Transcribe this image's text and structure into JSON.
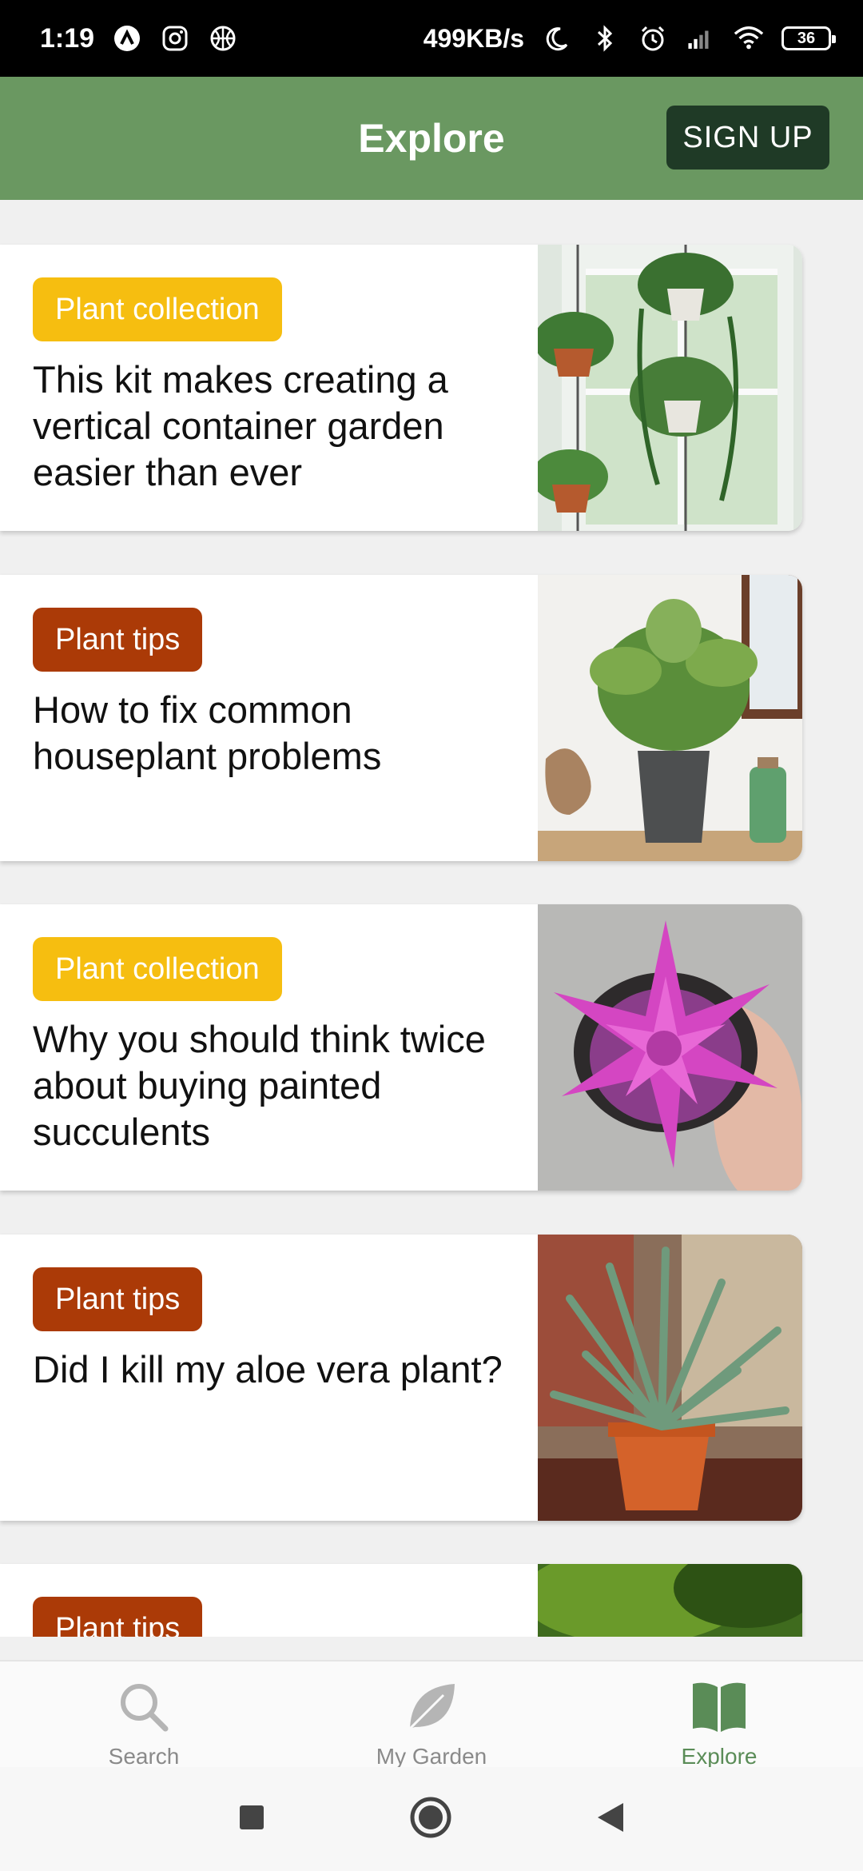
{
  "status_bar": {
    "time": "1:19",
    "net_speed": "499KB/s",
    "battery": "36"
  },
  "header": {
    "title": "Explore",
    "signup_label": "SIGN UP"
  },
  "articles": [
    {
      "category": "Plant collection",
      "title": "This kit makes creating a vertical container garden easier than ever",
      "image": "hanging-planters-photo"
    },
    {
      "category": "Plant tips",
      "title": "How to fix common houseplant problems",
      "image": "potted-houseplant-photo"
    },
    {
      "category": "Plant collection",
      "title": "Why you should think twice about buying painted succulents",
      "image": "pink-succulent-photo"
    },
    {
      "category": "Plant tips",
      "title": "Did I kill my aloe vera plant?",
      "image": "aloe-vera-photo"
    },
    {
      "category": "Plant tips",
      "title": "",
      "image": "green-foliage-photo"
    }
  ],
  "bottom_nav": {
    "items": [
      {
        "label": "Search",
        "icon": "search-icon"
      },
      {
        "label": "My Garden",
        "icon": "leaf-icon"
      },
      {
        "label": "Explore",
        "icon": "book-icon",
        "active": true
      }
    ]
  },
  "colors": {
    "header_bg": "#6a9861",
    "signup_bg": "#1f3a26",
    "badge_collection": "#f6be10",
    "badge_tips": "#ab3a07",
    "nav_active": "#5a8c57"
  }
}
